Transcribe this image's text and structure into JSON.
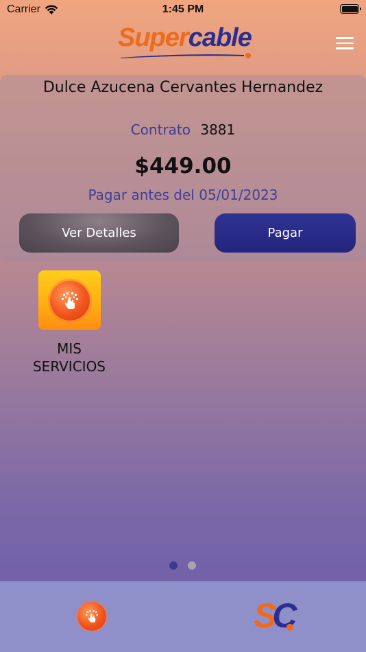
{
  "status_bar": {
    "carrier": "Carrier",
    "time": "1:45 PM"
  },
  "header": {
    "logo_part1": "Super",
    "logo_part2": "cable",
    "menu_icon": "hamburger-menu-icon"
  },
  "account": {
    "customer_name": "Dulce Azucena Cervantes Hernandez",
    "contract_label": "Contrato",
    "contract_number": "3881",
    "amount": "$449.00",
    "due_text": "Pagar antes del 05/01/2023"
  },
  "actions": {
    "details_label": "Ver Detalles",
    "pay_label": "Pagar"
  },
  "services": [
    {
      "label": "MIS SERVICIOS",
      "icon": "services-orb-icon"
    }
  ],
  "pagination": {
    "total": 2,
    "active": 1
  },
  "tab_bar": {
    "home_logo_s": "S",
    "home_logo_c": "C"
  },
  "colors": {
    "brand_orange": "#f06a1c",
    "brand_blue": "#2a2f8f",
    "tab_bar": "#8f8fc9"
  }
}
